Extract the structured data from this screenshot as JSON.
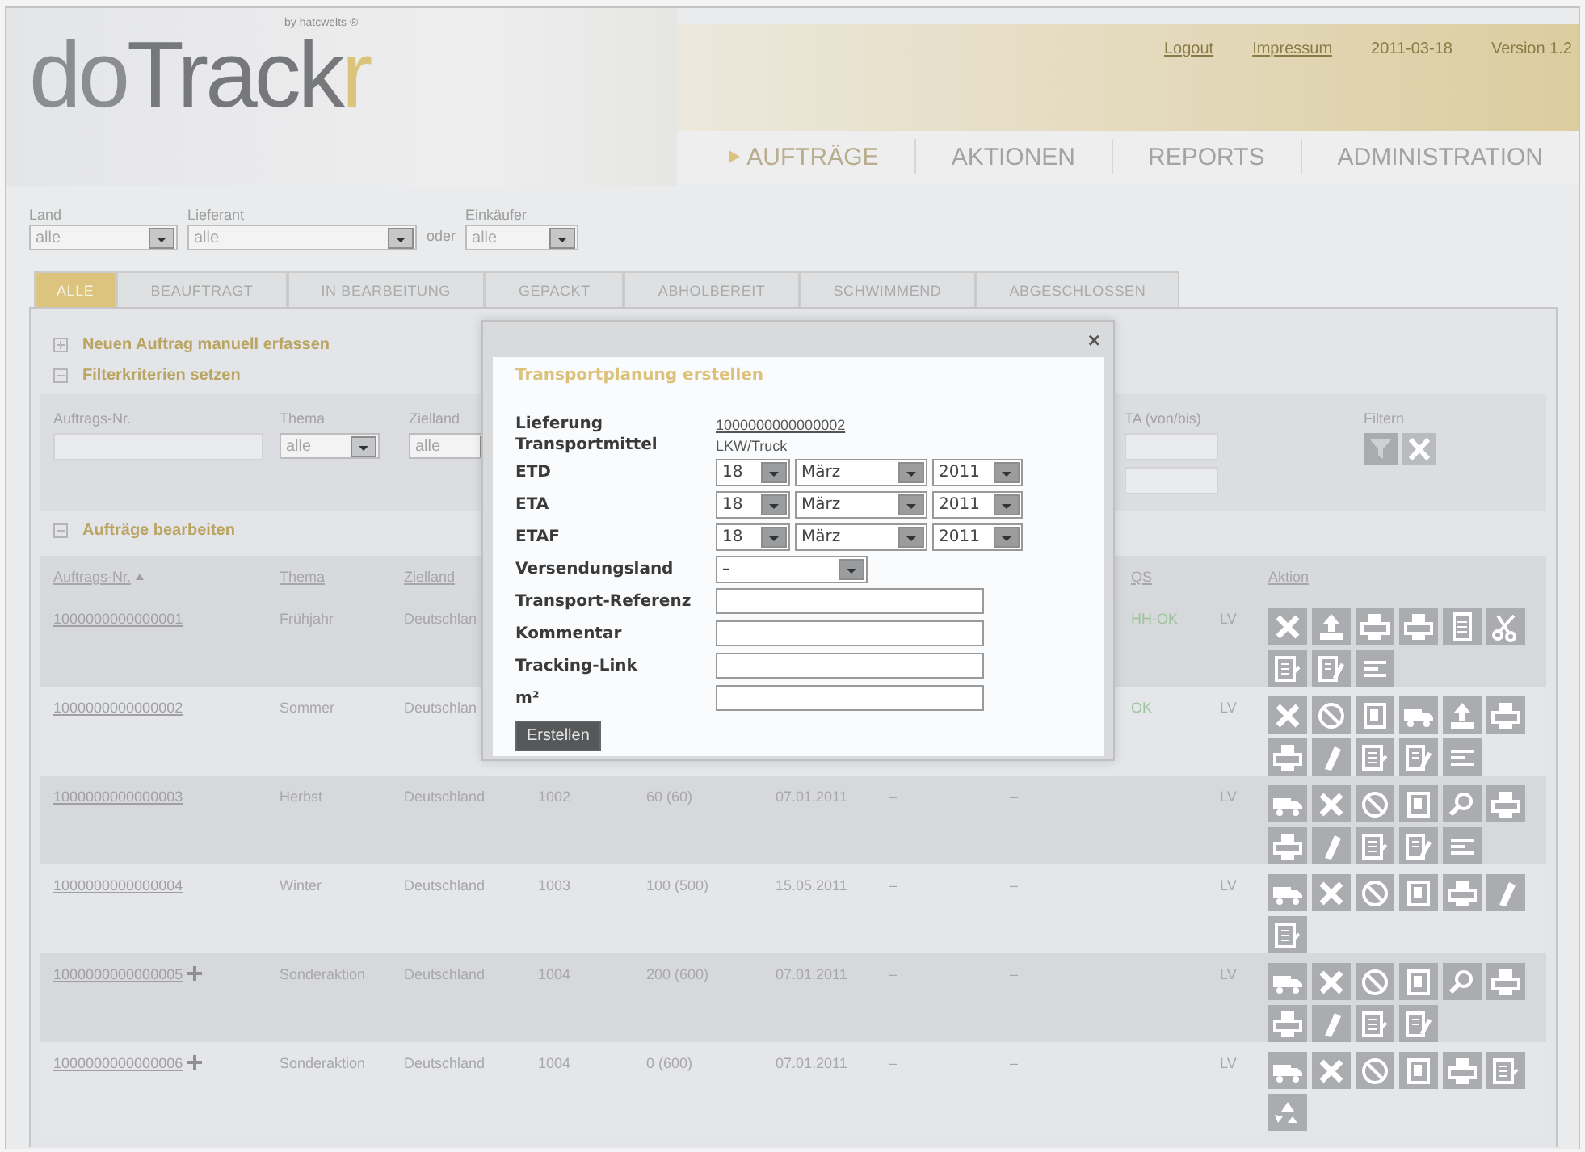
{
  "header": {
    "logo": {
      "part_1": "do",
      "part_2": "Track",
      "part_3": "r"
    },
    "tagline": "by hatcwelts ®",
    "links": [
      {
        "label": "Logout"
      },
      {
        "label": "Impressum"
      }
    ],
    "date": "2011-03-18",
    "version": "Version 1.2"
  },
  "nav": [
    {
      "label": "AUFTRÄGE",
      "selected": true
    },
    {
      "label": "AKTIONEN",
      "selected": false
    },
    {
      "label": "REPORTS",
      "selected": false
    },
    {
      "label": "ADMINISTRATION",
      "selected": false
    }
  ],
  "scope_filters": [
    {
      "label": "Land",
      "value": "alle"
    },
    {
      "label": "Lieferant",
      "value": "alle"
    },
    {
      "prefix": "oder",
      "label": "Einkäufer",
      "value": "alle"
    }
  ],
  "tabs": [
    {
      "label": "ALLE",
      "selected": true
    },
    {
      "label": "BEAUFTRAGT",
      "selected": false
    },
    {
      "label": "IN BEARBEITUNG",
      "selected": false
    },
    {
      "label": "GEPACKT",
      "selected": false
    },
    {
      "label": "ABHOLBEREIT",
      "selected": false
    },
    {
      "label": "SCHWIMMEND",
      "selected": false
    },
    {
      "label": "ABGESCHLOSSEN",
      "selected": false
    }
  ],
  "panel": {
    "sections": [
      {
        "label": "Neuen Auftrag manuell erfassen",
        "expanded": false
      },
      {
        "label": "Filterkriterien setzen",
        "expanded": true
      }
    ],
    "filter_box": {
      "fields": [
        {
          "kind": "text",
          "label": "Auftrags-Nr."
        },
        {
          "kind": "select",
          "label": "Thema",
          "value": "alle"
        },
        {
          "kind": "select",
          "label": "Zielland",
          "value": "alle"
        },
        {
          "kind": "range",
          "label": "TA (von/bis)"
        }
      ],
      "apply": {
        "label": "Filtern"
      }
    },
    "edit_section": {
      "label": "Aufträge bearbeiten",
      "expanded": true
    },
    "table": {
      "columns": [
        {
          "label": "Auftrags-Nr.",
          "sorted": true
        },
        {
          "label": "Thema",
          "sorted": false
        },
        {
          "label": "Zielland",
          "sorted": false
        },
        {
          "label": "QS",
          "sorted": false
        },
        {
          "label": "Aktion",
          "sorted": false
        }
      ],
      "rows": [
        {
          "number": "1000000000000001",
          "added": false,
          "theme": "Frühjahr",
          "country": "Deutschlan",
          "qs": "HH-OK",
          "column_10": "LV",
          "actions": [
            {
              "kind": "delete"
            },
            {
              "kind": "assign"
            },
            {
              "kind": "print"
            },
            {
              "kind": "print"
            },
            {
              "kind": "sheet"
            },
            {
              "kind": "cut"
            },
            {
              "kind": "note"
            },
            {
              "kind": "form"
            },
            {
              "kind": "lines"
            }
          ]
        },
        {
          "number": "1000000000000002",
          "added": false,
          "theme": "Sommer",
          "country": "Deutschlan",
          "qs": "OK",
          "column_10": "LV",
          "actions": [
            {
              "kind": "delete"
            },
            {
              "kind": "cancel"
            },
            {
              "kind": "frame"
            },
            {
              "kind": "ship"
            },
            {
              "kind": "assign"
            },
            {
              "kind": "print"
            },
            {
              "kind": "print"
            },
            {
              "kind": "pen"
            },
            {
              "kind": "note"
            },
            {
              "kind": "form"
            },
            {
              "kind": "lines"
            }
          ]
        },
        {
          "number": "1000000000000003",
          "added": false,
          "theme": "Herbst",
          "country": "Deutschland",
          "column_4": "1002",
          "column_5": "60 (60)",
          "column_6": "07.01.2011",
          "column_7": "–",
          "column_8": "–",
          "column_10": "LV",
          "actions": [
            {
              "kind": "ship"
            },
            {
              "kind": "delete"
            },
            {
              "kind": "cancel"
            },
            {
              "kind": "frame"
            },
            {
              "kind": "search"
            },
            {
              "kind": "print"
            },
            {
              "kind": "print"
            },
            {
              "kind": "pen"
            },
            {
              "kind": "note"
            },
            {
              "kind": "form"
            },
            {
              "kind": "lines"
            }
          ]
        },
        {
          "number": "1000000000000004",
          "added": false,
          "theme": "Winter",
          "country": "Deutschland",
          "column_4": "1003",
          "column_5": "100 (500)",
          "column_6": "15.05.2011",
          "column_7": "–",
          "column_8": "–",
          "column_10": "LV",
          "actions": [
            {
              "kind": "ship"
            },
            {
              "kind": "delete"
            },
            {
              "kind": "cancel"
            },
            {
              "kind": "frame"
            },
            {
              "kind": "print"
            },
            {
              "kind": "pen"
            },
            {
              "kind": "note"
            }
          ]
        },
        {
          "number": "1000000000000005",
          "added": true,
          "theme": "Sonderaktion",
          "country": "Deutschland",
          "column_4": "1004",
          "column_5": "200 (600)",
          "column_6": "07.01.2011",
          "column_7": "–",
          "column_8": "–",
          "column_10": "LV",
          "actions": [
            {
              "kind": "ship"
            },
            {
              "kind": "delete"
            },
            {
              "kind": "cancel"
            },
            {
              "kind": "frame"
            },
            {
              "kind": "search"
            },
            {
              "kind": "print"
            },
            {
              "kind": "print"
            },
            {
              "kind": "pen"
            },
            {
              "kind": "note"
            },
            {
              "kind": "form"
            }
          ]
        },
        {
          "number": "1000000000000006",
          "added": true,
          "theme": "Sonderaktion",
          "country": "Deutschland",
          "column_4": "1004",
          "column_5": "0 (600)",
          "column_6": "07.01.2011",
          "column_7": "–",
          "column_8": "–",
          "column_10": "LV",
          "actions": [
            {
              "kind": "ship"
            },
            {
              "kind": "delete"
            },
            {
              "kind": "cancel"
            },
            {
              "kind": "frame"
            },
            {
              "kind": "print"
            },
            {
              "kind": "note"
            },
            {
              "kind": "recycle"
            }
          ]
        }
      ]
    }
  },
  "dialog": {
    "close": "×",
    "title": "Transportplanung erstellen",
    "fields": [
      {
        "kind": "link",
        "label": "Lieferung",
        "value": "1000000000000002"
      },
      {
        "kind": "text",
        "label": "Transportmittel",
        "value": "LKW/Truck"
      },
      {
        "kind": "date",
        "label": "ETD",
        "day": "18",
        "month": "März",
        "year": "2011"
      },
      {
        "kind": "date",
        "label": "ETA",
        "day": "18",
        "month": "März",
        "year": "2011"
      },
      {
        "kind": "date",
        "label": "ETAF",
        "day": "18",
        "month": "März",
        "year": "2011"
      },
      {
        "kind": "select",
        "label": "Versendungsland",
        "value": "–"
      },
      {
        "kind": "input",
        "label": "Transport-Referenz"
      },
      {
        "kind": "input",
        "label": "Kommentar"
      },
      {
        "kind": "input",
        "label": "Tracking-Link"
      },
      {
        "kind": "input",
        "label": "m²"
      }
    ],
    "submit": "Erstellen"
  }
}
